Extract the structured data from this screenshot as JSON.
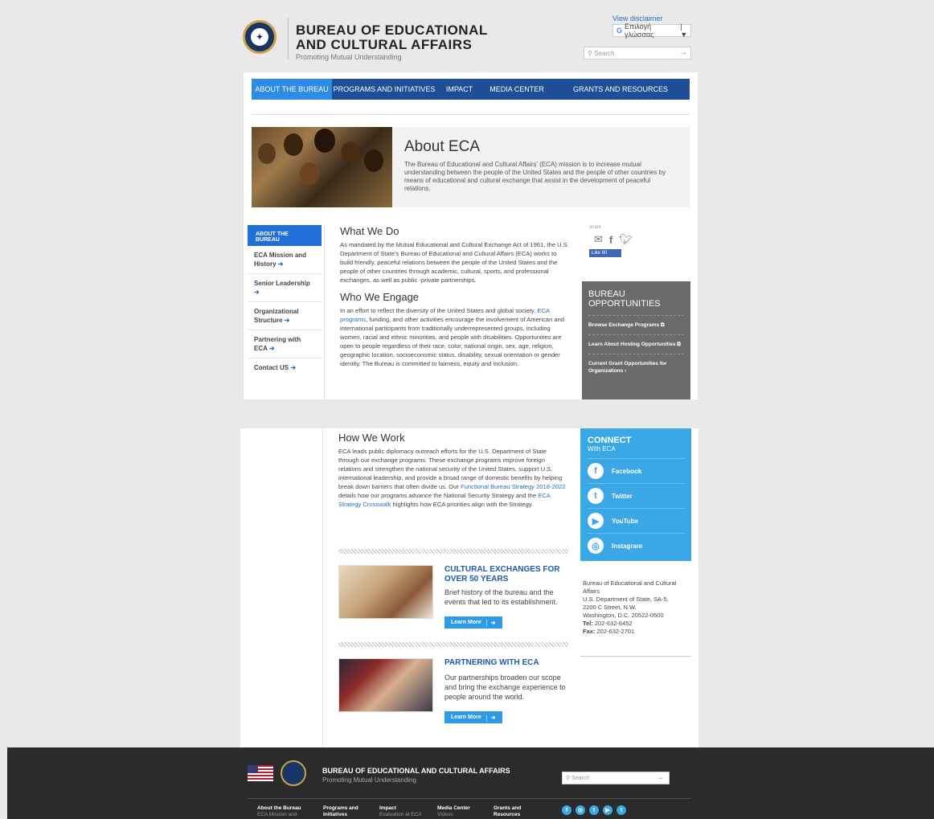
{
  "header": {
    "org_line1": "BUREAU OF EDUCATIONAL",
    "org_line2": "AND CULTURAL AFFAIRS",
    "tagline": "Promoting Mutual Understanding",
    "disclaimer": "View disclaimer",
    "translate_label": "Επιλογή γλώσσας",
    "search_placeholder": "Search"
  },
  "nav": {
    "items": [
      "ABOUT THE BUREAU",
      "PROGRAMS AND INITIATIVES",
      "IMPACT",
      "MEDIA CENTER",
      "GRANTS AND RESOURCES"
    ],
    "active": 0
  },
  "hero": {
    "title": "About ECA",
    "text": "The Bureau of Educational and Cultural Affairs' (ECA) mission is to increase mutual understanding between the people of the United States and the people of other countries by means of educational and cultural exchange that assist in the development of peaceful relations."
  },
  "sidebar": {
    "active": "ABOUT THE BUREAU",
    "links": [
      "ECA Mission and History",
      "Senior Leadership",
      "Organizational Structure",
      "Partnering with ECA",
      "Contact US"
    ],
    "arrow": "➔"
  },
  "main": {
    "what_title": "What We Do",
    "what_text": "As mandated by the Mutual Educational and Cultural Exchange Act of 1961, the U.S. Department of State's Bureau of Educational and Cultural Affairs (ECA) works to build friendly, peaceful relations between the people of the United States and the people of other countries through academic, cultural, sports, and professional exchanges, as well as public -private partnerships.",
    "who_title": "Who We Engage",
    "who_text_pre": "In an effort to reflect the diversity of the United States and global society, ",
    "who_link": "ECA programs",
    "who_text_post": ", funding, and other activities encourage the involvement of American and international participants from traditionally underrepresented groups, including women, racial and ethnic minorities, and people with disabilities. Opportunities are open to people regardless of their race, color, national origin, sex, age, religion, geographic location, socioeconomic status, disability, sexual orientation or gender identity. The Bureau is committed to fairness, equity and inclusion.",
    "how_title": "How We Work",
    "how_text_1": "ECA leads public diplomacy outreach efforts for the U.S. Department of State through our exchange programs. These exchange programs improve foreign relations and strengthen the national security of the United States, support U.S. international leadership, and provide a broad range of domestic benefits by helping break down barriers that often divide us. Our ",
    "how_link_1": "Functional Bureau Strategy 2018-2022",
    "how_text_2": " details how our programs advance the National Security Strategy and the ",
    "how_link_2": "ECA Strategy Crosswalk",
    "how_text_3": " highlights how ECA priorities align with the Strategy."
  },
  "share": {
    "label": "share",
    "like": "Like 60"
  },
  "opportunities": {
    "title": "BUREAU OPPORTUNITIES",
    "items": [
      "Browse Exchange Programs",
      "Learn About Hosting Opportunities",
      "Current Grant Opportunities for Organizations"
    ]
  },
  "features": [
    {
      "title": "CULTURAL EXCHANGES FOR OVER 50 YEARS",
      "text": "Brief history of the bureau and the events that led to its establishment.",
      "button": "Learn More"
    },
    {
      "title": "PARTNERING WITH ECA",
      "text": "Our partnerships broaden our scope and bring the exchange experience to people around the world.",
      "button": "Learn More"
    }
  ],
  "connect": {
    "title": "CONNECT",
    "subtitle": "With ECA",
    "items": [
      {
        "label": "Facebook",
        "glyph": "f"
      },
      {
        "label": "Twitter",
        "glyph": "t"
      },
      {
        "label": "YouTube",
        "glyph": "▶"
      },
      {
        "label": "Instagram",
        "glyph": "◎"
      }
    ]
  },
  "address": {
    "name": "Bureau of Educational and Cultural Affairs",
    "line1": "U.S. Department of State, SA-5,",
    "line2": "2200 C Street, N.W.",
    "line3": "Washington, D.C. 20522-0500",
    "tel_label": "Tel:",
    "tel": "202-632-6452",
    "fax_label": "Fax:",
    "fax": "202-632-2701"
  },
  "footer": {
    "title": "BUREAU OF EDUCATIONAL AND CULTURAL AFFAIRS",
    "tagline": "Promoting Mutual Understanding",
    "search_placeholder": "Search",
    "nav": [
      {
        "label": "About the Bureau",
        "sub": "ECA Mission and"
      },
      {
        "label": "Programs and Initiatives",
        "sub": ""
      },
      {
        "label": "Impact",
        "sub": "Evaluation at ECA"
      },
      {
        "label": "Media Center",
        "sub": "Videos"
      },
      {
        "label": "Grants and Resources",
        "sub": ""
      }
    ],
    "social": [
      "f",
      "◎",
      "t",
      "▶",
      "t"
    ]
  },
  "colors": {
    "nav_bg": "#1f4e99",
    "nav_active": "#2f8ce6",
    "link": "#2a6fb6",
    "connect_bg": "#3aa7e6",
    "opps_bg": "#6b6b6b",
    "footer_bg": "#2b2b2b"
  }
}
